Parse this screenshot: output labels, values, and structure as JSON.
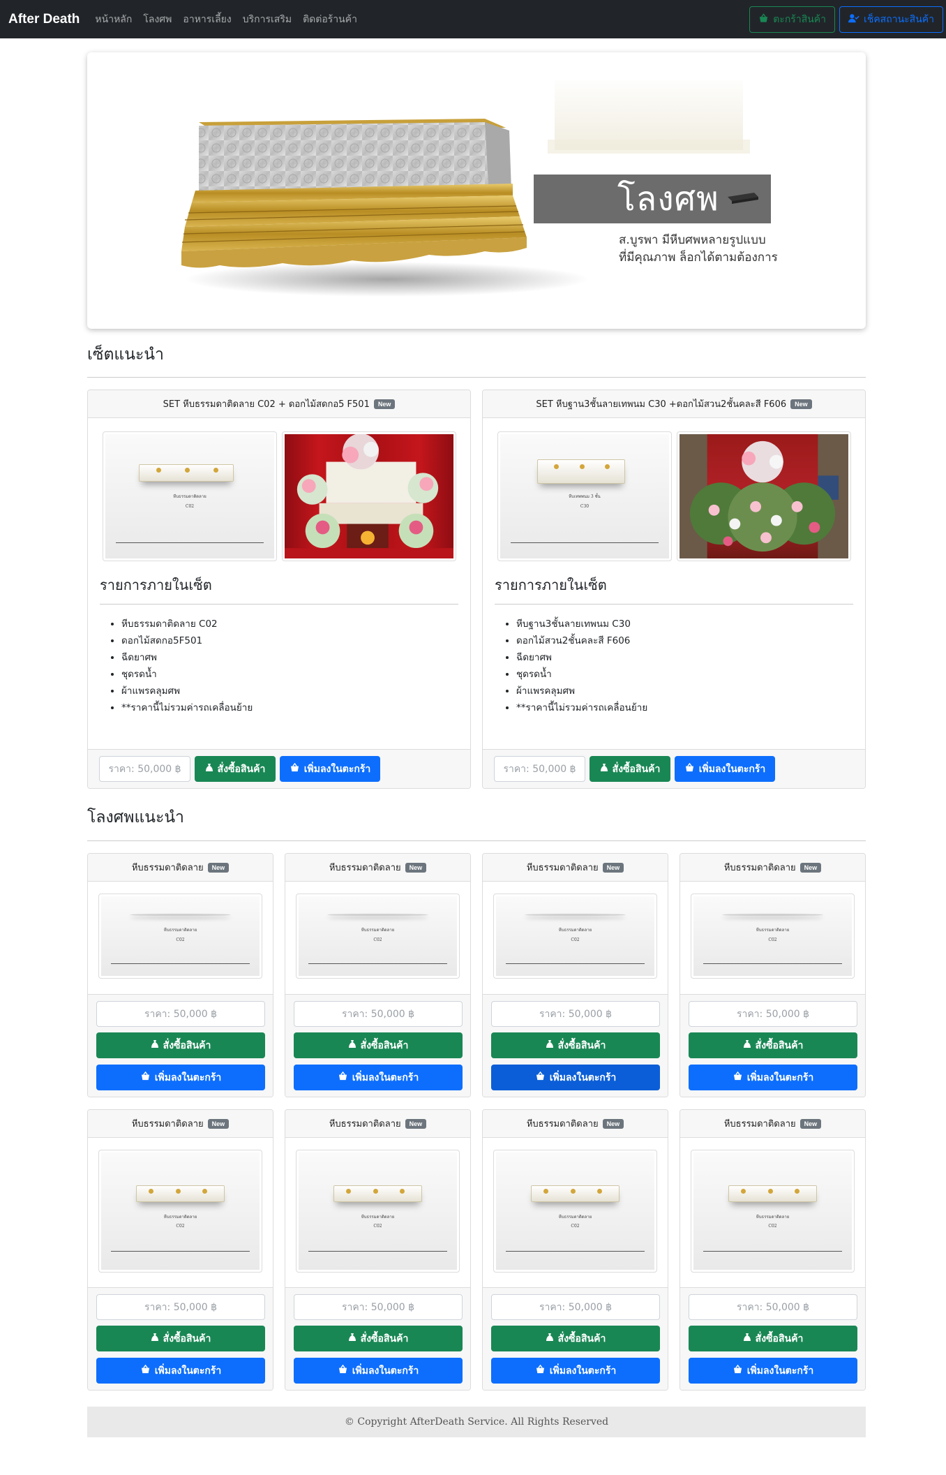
{
  "nav": {
    "brand": "After Death",
    "links": [
      "หน้าหลัก",
      "โลงศพ",
      "อาหารเลี้ยง",
      "บริการเสริม",
      "ติดต่อร้านค้า"
    ],
    "cart_label": "ตะกร้าสินค้า",
    "status_label": "เช็คสถานะสินค้า"
  },
  "hero": {
    "title": "โลงศพ",
    "subtitle_line1": "ส.บูรพา มีหีบศพหลายรูปแบบ",
    "subtitle_line2": "ที่มีคุณภาพ ล็อกได้ตามต้องการ"
  },
  "sets_section": {
    "title": "เซ็ตแนะนำ",
    "items_heading": "รายการภายในเซ็ต",
    "badge": "New",
    "price": "ราคา: 50,000 ฿",
    "buy_label": "สั่งซื้อสินค้า",
    "cart_label": "เพิ่มลงในตะกร้า",
    "sets": [
      {
        "name": "SET หีบธรรมดาติดลาย C02 + ดอกไม้สดกอ5 F501",
        "caption_top": "หีบธรรมดาติดลาย",
        "caption_code": "C02",
        "items": [
          "หีบธรรมดาติดลาย C02",
          "ดอกไม้สดกอ5F501",
          "ฉีดยาศพ",
          "ชุดรดน้ำ",
          "ผ้าแพรคลุมศพ",
          "**ราคานี้ไม่รวมค่ารถเคลื่อนย้าย"
        ]
      },
      {
        "name": "SET หีบฐาน3ชั้นลายเทพนม C30 +ดอกไม้สวน2ชั้นคละสี F606",
        "caption_top": "หีบเทพพนม 3 ชั้น",
        "caption_code": "C30",
        "items": [
          "หีบฐาน3ชั้นลายเทพนม C30",
          "ดอกไม้สวน2ชั้นคละสี F606",
          "ฉีดยาศพ",
          "ชุดรดน้ำ",
          "ผ้าแพรคลุมศพ",
          "**ราคานี้ไม่รวมค่ารถเคลื่อนย้าย"
        ]
      }
    ]
  },
  "coffins_section": {
    "title": "โลงศพแนะนำ",
    "badge": "New",
    "price": "ราคา: 50,000 ฿",
    "buy_label": "สั่งซื้อสินค้า",
    "cart_label": "เพิ่มลงในตะกร้า",
    "caption_top": "หีบธรรมดาติดลาย",
    "caption_code": "C02",
    "products": [
      {
        "name": "หีบธรรมดาติดลาย"
      },
      {
        "name": "หีบธรรมดาติดลาย"
      },
      {
        "name": "หีบธรรมดาติดลาย"
      },
      {
        "name": "หีบธรรมดาติดลาย"
      },
      {
        "name": "หีบธรรมดาติดลาย"
      },
      {
        "name": "หีบธรรมดาติดลาย"
      },
      {
        "name": "หีบธรรมดาติดลาย"
      },
      {
        "name": "หีบธรรมดาติดลาย"
      }
    ]
  },
  "footer": {
    "copyright": "© Copyright AfterDeath Service. All Rights Reserved"
  },
  "colors": {
    "navbar": "#212529",
    "success": "#198754",
    "primary": "#0d6efd",
    "badge": "#6c757d"
  }
}
